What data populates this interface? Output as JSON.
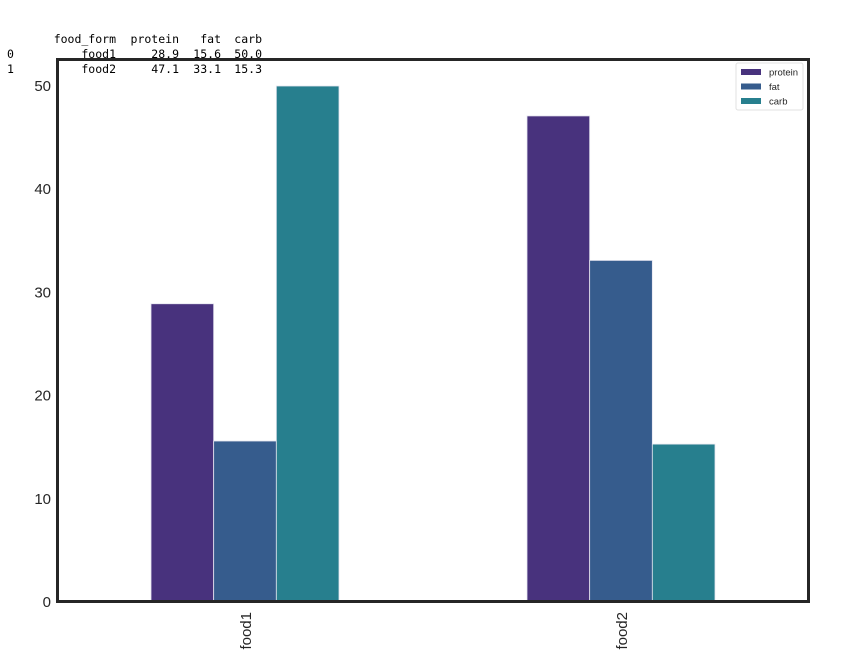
{
  "dataframe": {
    "columns": [
      "",
      "food_form",
      "protein",
      "fat",
      "carb"
    ],
    "rows": [
      [
        "0",
        "food1",
        "28.9",
        "15.6",
        "50.0"
      ],
      [
        "1",
        "food2",
        "47.1",
        "33.1",
        "15.3"
      ]
    ]
  },
  "chart_data": {
    "type": "bar",
    "title": "",
    "xlabel": "",
    "ylabel": "",
    "categories": [
      "food1",
      "food2"
    ],
    "series": [
      {
        "name": "protein",
        "values": [
          28.9,
          47.1
        ],
        "color": "#48327d"
      },
      {
        "name": "fat",
        "values": [
          15.6,
          33.1
        ],
        "color": "#365c8d"
      },
      {
        "name": "carb",
        "values": [
          50.0,
          15.3
        ],
        "color": "#277f8e"
      }
    ],
    "ylim": [
      0,
      52.5
    ],
    "yticks": [
      0,
      10,
      20,
      30,
      40,
      50
    ],
    "ytick_labels": [
      "0",
      "10",
      "20",
      "30",
      "40",
      "50"
    ],
    "xtick_rotation": "vertical",
    "grid": false,
    "legend": {
      "position": "top-right",
      "entries": [
        "protein",
        "fat",
        "carb"
      ]
    }
  }
}
